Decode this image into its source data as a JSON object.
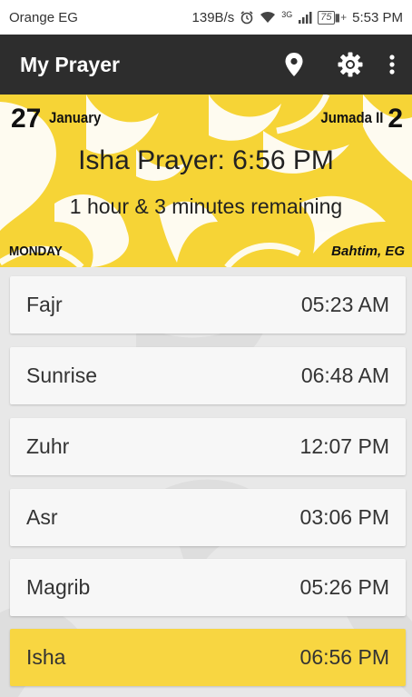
{
  "status_bar": {
    "carrier": "Orange EG",
    "speed": "139B/s",
    "network": "3G",
    "battery": "75",
    "time": "5:53 PM"
  },
  "app_bar": {
    "title": "My Prayer",
    "icons": [
      "location-pin-icon",
      "settings-gear-icon",
      "overflow-menu-icon"
    ],
    "background": "#2d2d2d"
  },
  "banner": {
    "day_number": "27",
    "month": "January",
    "hijri_month": "Jumada II",
    "hijri_day": "2",
    "next_prayer": "Isha Prayer: 6:56 PM",
    "remaining": "1 hour & 3 minutes remaining",
    "weekday": "MONDAY",
    "location": "Bahtim, EG",
    "background": "#f6d436"
  },
  "prayers": [
    {
      "name": "Fajr",
      "time": "05:23 AM",
      "active": false
    },
    {
      "name": "Sunrise",
      "time": "06:48 AM",
      "active": false
    },
    {
      "name": "Zuhr",
      "time": "12:07 PM",
      "active": false
    },
    {
      "name": "Asr",
      "time": "03:06 PM",
      "active": false
    },
    {
      "name": "Magrib",
      "time": "05:26 PM",
      "active": false
    },
    {
      "name": "Isha",
      "time": "06:56 PM",
      "active": true
    }
  ],
  "colors": {
    "accent": "#f8d641",
    "row_bg": "#f7f7f7"
  }
}
